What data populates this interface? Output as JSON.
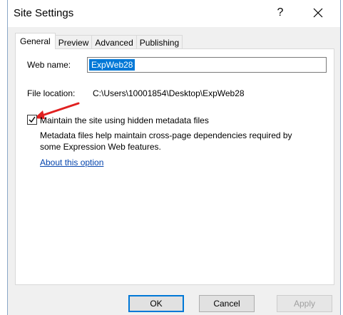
{
  "window": {
    "title": "Site Settings",
    "help_label": "?",
    "close_icon": "close-icon"
  },
  "tabs": [
    {
      "label": "General",
      "active": true
    },
    {
      "label": "Preview",
      "active": false
    },
    {
      "label": "Advanced",
      "active": false
    },
    {
      "label": "Publishing",
      "active": false
    }
  ],
  "general": {
    "web_name_label": "Web name:",
    "web_name_value": "ExpWeb28",
    "file_location_label": "File location:",
    "file_location_value": "C:\\Users\\10001854\\Desktop\\ExpWeb28",
    "metadata_checkbox_label": "Maintain the site using hidden metadata files",
    "metadata_checked": true,
    "metadata_desc_line1": "Metadata files help maintain cross-page dependencies required by",
    "metadata_desc_line2": "some Expression Web features.",
    "about_link": "About this option"
  },
  "buttons": {
    "ok": "OK",
    "cancel": "Cancel",
    "apply": "Apply"
  },
  "colors": {
    "accent": "#0078d7",
    "link": "#0645ad",
    "annotation_arrow": "#e02020"
  }
}
